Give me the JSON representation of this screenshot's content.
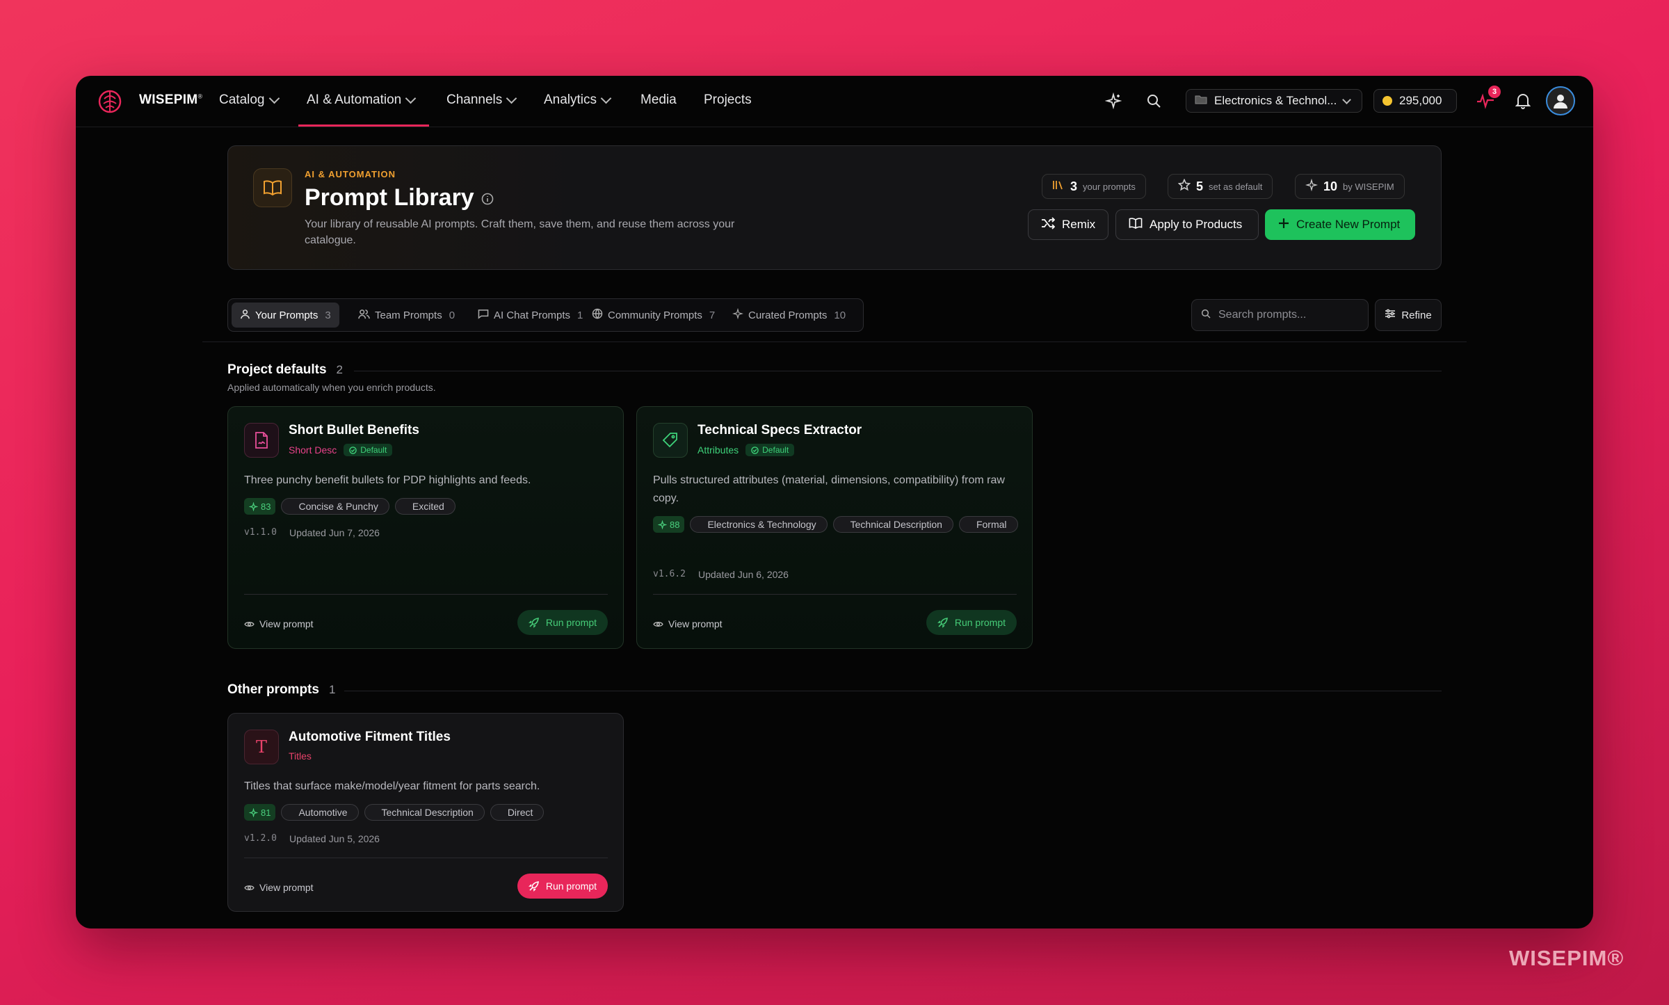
{
  "nav": {
    "brand": "WISEPIM",
    "items": [
      {
        "label": "Catalog"
      },
      {
        "label": "AI & Automation"
      },
      {
        "label": "Channels"
      },
      {
        "label": "Analytics"
      },
      {
        "label": "Media"
      },
      {
        "label": "Projects"
      }
    ],
    "workspace": "Electronics & Technol...",
    "credits": "295,000",
    "activity_badge": "3"
  },
  "hero": {
    "eyebrow": "AI & AUTOMATION",
    "title": "Prompt Library",
    "description": "Your library of reusable AI prompts. Craft them, save them, and reuse them across your catalogue.",
    "stats": [
      {
        "value": "3",
        "label": "your prompts"
      },
      {
        "value": "5",
        "label": "set as default"
      },
      {
        "value": "10",
        "label": "by WISEPIM"
      }
    ],
    "buttons": {
      "remix": "Remix",
      "apply": "Apply to Products",
      "create": "Create New Prompt"
    }
  },
  "tabs": [
    {
      "label": "Your Prompts",
      "count": "3"
    },
    {
      "label": "Team Prompts",
      "count": "0"
    },
    {
      "label": "AI Chat Prompts",
      "count": "1"
    },
    {
      "label": "Community Prompts",
      "count": "7"
    },
    {
      "label": "Curated Prompts",
      "count": "10"
    }
  ],
  "search": {
    "placeholder": "Search prompts..."
  },
  "refine": "Refine",
  "sections": {
    "defaults": {
      "title": "Project defaults",
      "count": "2",
      "subtitle": "Applied automatically when you enrich products."
    },
    "other": {
      "title": "Other prompts",
      "count": "1"
    }
  },
  "cards": [
    {
      "title": "Short Bullet Benefits",
      "category": "Short Desc",
      "default_label": "Default",
      "description": "Three punchy benefit bullets for PDP highlights and feeds.",
      "score": "83",
      "tags": [
        "Concise & Punchy",
        "Excited"
      ],
      "version": "v1.1.0",
      "updated": "Updated Jun 7, 2026",
      "view": "View prompt",
      "run": "Run prompt"
    },
    {
      "title": "Technical Specs Extractor",
      "category": "Attributes",
      "default_label": "Default",
      "description": "Pulls structured attributes (material, dimensions, compatibility) from raw copy.",
      "score": "88",
      "tags": [
        "Electronics & Technology",
        "Technical Description",
        "Formal"
      ],
      "version": "v1.6.2",
      "updated": "Updated Jun 6, 2026",
      "view": "View prompt",
      "run": "Run prompt"
    },
    {
      "title": "Automotive Fitment Titles",
      "category": "Titles",
      "description": "Titles that surface make/model/year fitment for parts search.",
      "score": "81",
      "tags": [
        "Automotive",
        "Technical Description",
        "Direct"
      ],
      "version": "v1.2.0",
      "updated": "Updated Jun 5, 2026",
      "view": "View prompt",
      "run": "Run prompt"
    }
  ],
  "watermark": "WISEPIM®",
  "colors": {
    "accent": "#e8265a",
    "green": "#1ec25c",
    "amber": "#f0a030",
    "background": "#050505"
  }
}
